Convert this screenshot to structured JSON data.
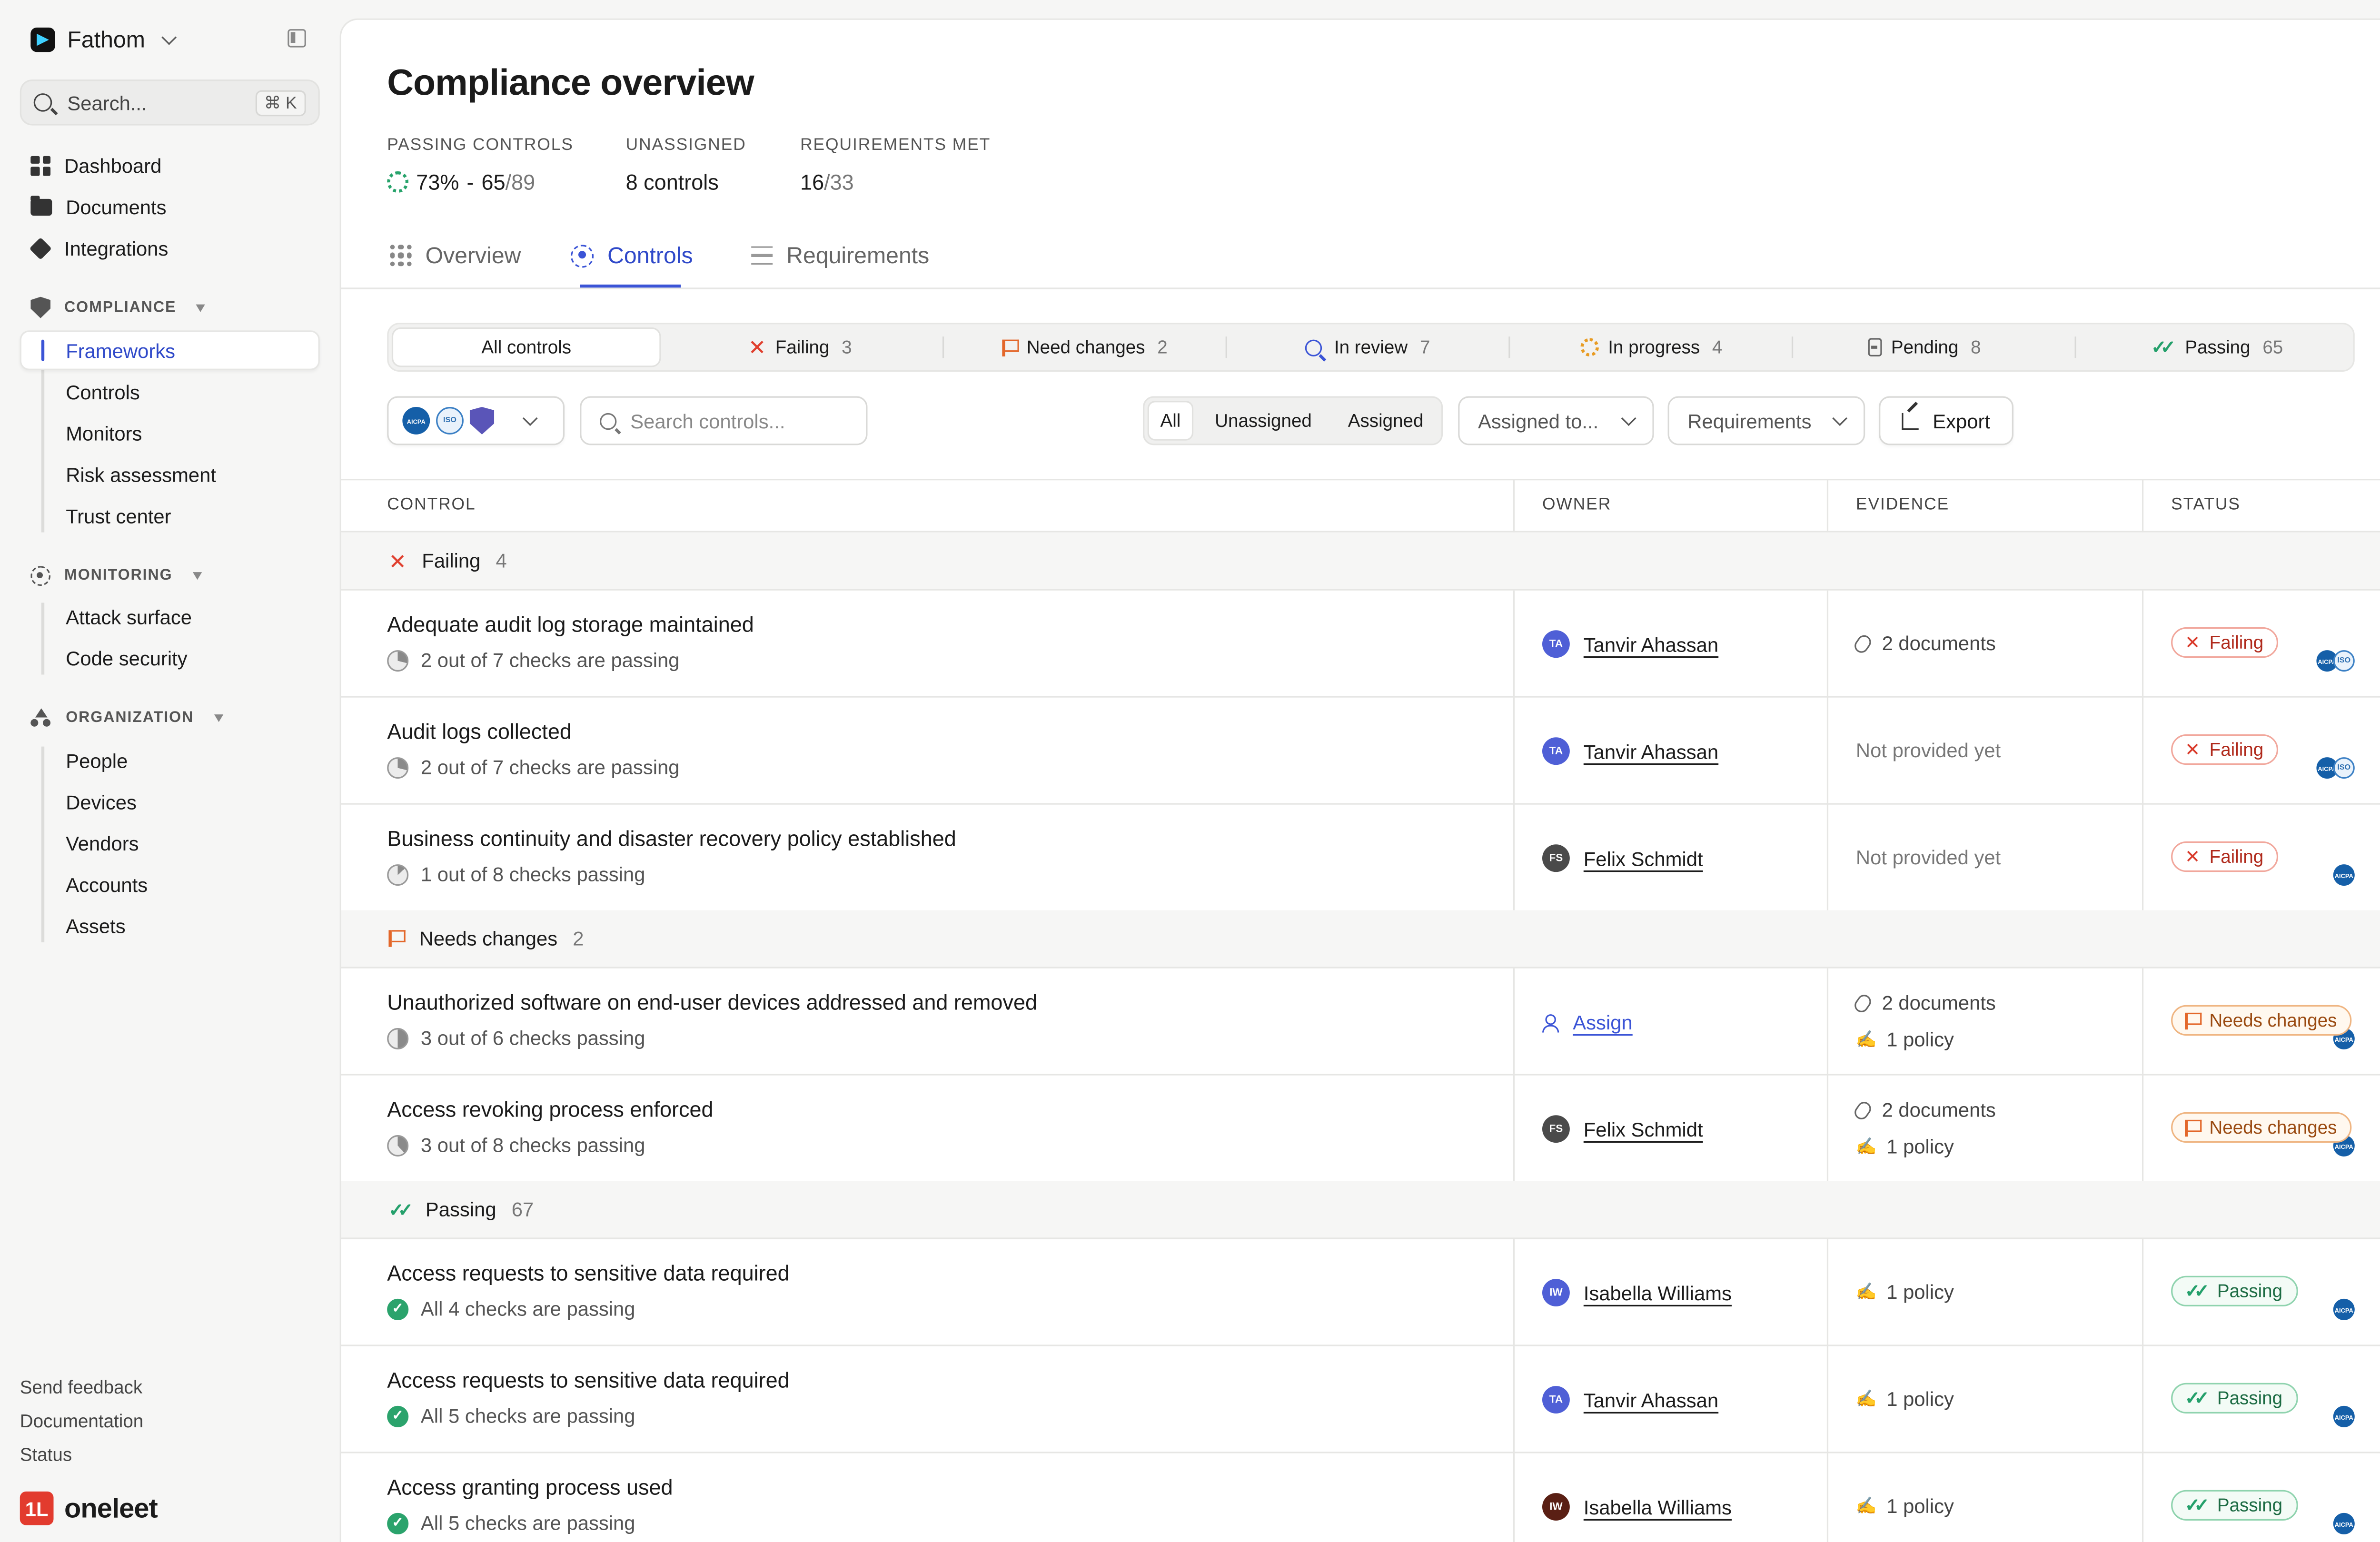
{
  "workspace": {
    "name": "Fathom"
  },
  "search": {
    "placeholder": "Search...",
    "shortcut": "⌘ K"
  },
  "nav": {
    "main": [
      {
        "label": "Dashboard",
        "icon": "dashboard-icon"
      },
      {
        "label": "Documents",
        "icon": "folder-icon"
      },
      {
        "label": "Integrations",
        "icon": "integrations-icon"
      }
    ],
    "compliance": {
      "heading": "COMPLIANCE",
      "items": [
        "Frameworks",
        "Controls",
        "Monitors",
        "Risk assessment",
        "Trust center"
      ],
      "active": "Frameworks"
    },
    "monitoring": {
      "heading": "MONITORING",
      "items": [
        "Attack surface",
        "Code security"
      ]
    },
    "organization": {
      "heading": "ORGANIZATION",
      "items": [
        "People",
        "Devices",
        "Vendors",
        "Accounts",
        "Assets"
      ]
    },
    "footer": [
      "Send feedback",
      "Documentation",
      "Status"
    ],
    "brand": "oneleet",
    "brand_mark": "1L"
  },
  "page": {
    "title": "Compliance overview",
    "stats": [
      {
        "label": "PASSING CONTROLS",
        "value": "73%",
        "sep": "-",
        "num": "65",
        "den": "/89"
      },
      {
        "label": "UNASSIGNED",
        "value": "8 controls"
      },
      {
        "label": "REQUIREMENTS MET",
        "num": "16",
        "den": "/33"
      }
    ],
    "tabs": [
      {
        "label": "Overview",
        "icon": "grid-dots-icon",
        "active": false
      },
      {
        "label": "Controls",
        "icon": "target-icon",
        "active": true
      },
      {
        "label": "Requirements",
        "icon": "checklist-icon",
        "active": false
      }
    ]
  },
  "status_filters": [
    {
      "label": "All controls",
      "count": ""
    },
    {
      "label": "Failing",
      "count": "3"
    },
    {
      "label": "Need changes",
      "count": "2"
    },
    {
      "label": "In review",
      "count": "7"
    },
    {
      "label": "In progress",
      "count": "4"
    },
    {
      "label": "Pending",
      "count": "8"
    },
    {
      "label": "Passing",
      "count": "65"
    }
  ],
  "toolbar": {
    "frameworks": [
      "AICPA SOC",
      "ISO",
      "shield"
    ],
    "search_placeholder": "Search controls...",
    "segments": [
      "All",
      "Unassigned",
      "Assigned"
    ],
    "assigned_to": "Assigned to...",
    "requirements": "Requirements",
    "export": "Export"
  },
  "table": {
    "headers": [
      "CONTROL",
      "OWNER",
      "EVIDENCE",
      "STATUS"
    ],
    "groups": [
      {
        "label": "Failing",
        "count": "4"
      },
      {
        "label": "Needs changes",
        "count": "2"
      },
      {
        "label": "Passing",
        "count": "67"
      }
    ],
    "rows": [
      {
        "name": "Adequate audit log storage maintained",
        "checks": "2 out of 7 checks are passing",
        "pass_fraction": 0.29,
        "frameworks": [
          "AICPA SOC",
          "ISO"
        ],
        "owner": "Tanvir Ahassan",
        "initials": "TA",
        "avatar_color": "#4f5fd6",
        "evidence": [
          "2 documents"
        ],
        "evidence_icons": [
          "paperclip-icon"
        ],
        "status": "Failing"
      },
      {
        "name": "Audit logs collected",
        "checks": "2 out of 7 checks are passing",
        "pass_fraction": 0.29,
        "frameworks": [
          "AICPA SOC",
          "ISO"
        ],
        "owner": "Tanvir Ahassan",
        "initials": "TA",
        "avatar_color": "#4f5fd6",
        "evidence": [
          "Not provided yet"
        ],
        "evidence_icons": [],
        "status": "Failing"
      },
      {
        "name": "Business continuity and disaster recovery policy established",
        "checks": "1 out of 8 checks passing",
        "pass_fraction": 0.13,
        "frameworks": [
          "AICPA SOC"
        ],
        "owner": "Felix Schmidt",
        "initials": "FS",
        "avatar_color": "#4a4a4a",
        "evidence": [
          "Not provided yet"
        ],
        "evidence_icons": [],
        "status": "Failing"
      },
      {
        "name": "Unauthorized software on end-user devices addressed and removed",
        "checks": "3 out of 6 checks passing",
        "pass_fraction": 0.5,
        "frameworks": [
          "AICPA SOC"
        ],
        "owner": "Assign",
        "initials": "",
        "avatar_color": "",
        "evidence": [
          "2 documents",
          "1 policy"
        ],
        "evidence_icons": [
          "paperclip-icon",
          "signature-icon"
        ],
        "status": "Needs changes"
      },
      {
        "name": "Access revoking process enforced",
        "checks": "3 out of 8 checks passing",
        "pass_fraction": 0.38,
        "frameworks": [
          "AICPA SOC"
        ],
        "owner": "Felix Schmidt",
        "initials": "FS",
        "avatar_color": "#4a4a4a",
        "evidence": [
          "2 documents",
          "1 policy"
        ],
        "evidence_icons": [
          "paperclip-icon",
          "signature-icon"
        ],
        "status": "Needs changes"
      },
      {
        "name": "Access requests to sensitive data required",
        "checks": "All 4 checks are passing",
        "pass_fraction": 1,
        "frameworks": [
          "AICPA SOC"
        ],
        "owner": "Isabella Williams",
        "initials": "IW",
        "avatar_color": "#4f5fd6",
        "evidence": [
          "1 policy"
        ],
        "evidence_icons": [
          "signature-icon"
        ],
        "status": "Passing"
      },
      {
        "name": "Access requests to sensitive data required",
        "checks": "All 5 checks are passing",
        "pass_fraction": 1,
        "frameworks": [
          "AICPA SOC"
        ],
        "owner": "Tanvir Ahassan",
        "initials": "TA",
        "avatar_color": "#4f5fd6",
        "evidence": [
          "1 policy"
        ],
        "evidence_icons": [
          "signature-icon"
        ],
        "status": "Passing"
      },
      {
        "name": "Access granting process used",
        "checks": "All 5 checks are passing",
        "pass_fraction": 1,
        "frameworks": [
          "AICPA SOC"
        ],
        "owner": "Isabella Williams",
        "initials": "IW",
        "avatar_color": "#5a1f14",
        "evidence": [
          "1 policy"
        ],
        "evidence_icons": [
          "signature-icon"
        ],
        "status": "Passing"
      }
    ]
  }
}
